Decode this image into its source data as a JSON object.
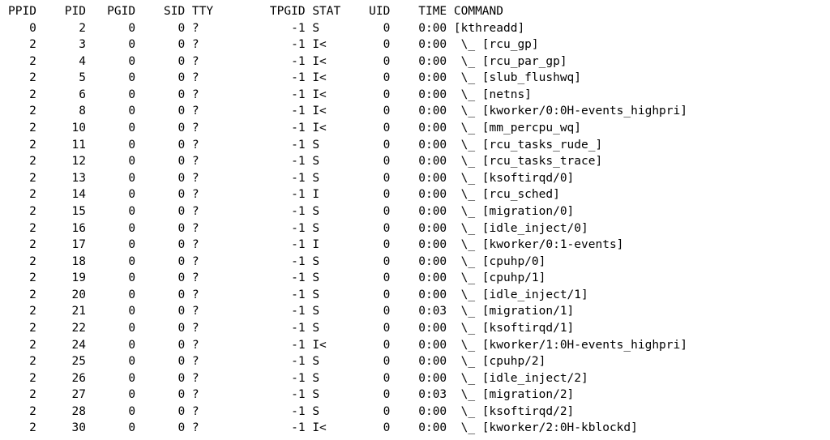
{
  "columns": {
    "ppid": "PPID",
    "pid": "PID",
    "pgid": "PGID",
    "sid": "SID",
    "tty": "TTY",
    "tpgid": "TPGID",
    "stat": "STAT",
    "uid": "UID",
    "time": "TIME",
    "command": "COMMAND"
  },
  "tree_prefix": " \\_ ",
  "rows": [
    {
      "ppid": "0",
      "pid": "2",
      "pgid": "0",
      "sid": "0",
      "tty": "?",
      "tpgid": "-1",
      "stat": "S",
      "uid": "0",
      "time": "0:00",
      "cmd": "[kthreadd]",
      "child": false
    },
    {
      "ppid": "2",
      "pid": "3",
      "pgid": "0",
      "sid": "0",
      "tty": "?",
      "tpgid": "-1",
      "stat": "I<",
      "uid": "0",
      "time": "0:00",
      "cmd": "[rcu_gp]",
      "child": true
    },
    {
      "ppid": "2",
      "pid": "4",
      "pgid": "0",
      "sid": "0",
      "tty": "?",
      "tpgid": "-1",
      "stat": "I<",
      "uid": "0",
      "time": "0:00",
      "cmd": "[rcu_par_gp]",
      "child": true
    },
    {
      "ppid": "2",
      "pid": "5",
      "pgid": "0",
      "sid": "0",
      "tty": "?",
      "tpgid": "-1",
      "stat": "I<",
      "uid": "0",
      "time": "0:00",
      "cmd": "[slub_flushwq]",
      "child": true
    },
    {
      "ppid": "2",
      "pid": "6",
      "pgid": "0",
      "sid": "0",
      "tty": "?",
      "tpgid": "-1",
      "stat": "I<",
      "uid": "0",
      "time": "0:00",
      "cmd": "[netns]",
      "child": true
    },
    {
      "ppid": "2",
      "pid": "8",
      "pgid": "0",
      "sid": "0",
      "tty": "?",
      "tpgid": "-1",
      "stat": "I<",
      "uid": "0",
      "time": "0:00",
      "cmd": "[kworker/0:0H-events_highpri]",
      "child": true
    },
    {
      "ppid": "2",
      "pid": "10",
      "pgid": "0",
      "sid": "0",
      "tty": "?",
      "tpgid": "-1",
      "stat": "I<",
      "uid": "0",
      "time": "0:00",
      "cmd": "[mm_percpu_wq]",
      "child": true
    },
    {
      "ppid": "2",
      "pid": "11",
      "pgid": "0",
      "sid": "0",
      "tty": "?",
      "tpgid": "-1",
      "stat": "S",
      "uid": "0",
      "time": "0:00",
      "cmd": "[rcu_tasks_rude_]",
      "child": true
    },
    {
      "ppid": "2",
      "pid": "12",
      "pgid": "0",
      "sid": "0",
      "tty": "?",
      "tpgid": "-1",
      "stat": "S",
      "uid": "0",
      "time": "0:00",
      "cmd": "[rcu_tasks_trace]",
      "child": true
    },
    {
      "ppid": "2",
      "pid": "13",
      "pgid": "0",
      "sid": "0",
      "tty": "?",
      "tpgid": "-1",
      "stat": "S",
      "uid": "0",
      "time": "0:00",
      "cmd": "[ksoftirqd/0]",
      "child": true
    },
    {
      "ppid": "2",
      "pid": "14",
      "pgid": "0",
      "sid": "0",
      "tty": "?",
      "tpgid": "-1",
      "stat": "I",
      "uid": "0",
      "time": "0:00",
      "cmd": "[rcu_sched]",
      "child": true
    },
    {
      "ppid": "2",
      "pid": "15",
      "pgid": "0",
      "sid": "0",
      "tty": "?",
      "tpgid": "-1",
      "stat": "S",
      "uid": "0",
      "time": "0:00",
      "cmd": "[migration/0]",
      "child": true
    },
    {
      "ppid": "2",
      "pid": "16",
      "pgid": "0",
      "sid": "0",
      "tty": "?",
      "tpgid": "-1",
      "stat": "S",
      "uid": "0",
      "time": "0:00",
      "cmd": "[idle_inject/0]",
      "child": true
    },
    {
      "ppid": "2",
      "pid": "17",
      "pgid": "0",
      "sid": "0",
      "tty": "?",
      "tpgid": "-1",
      "stat": "I",
      "uid": "0",
      "time": "0:00",
      "cmd": "[kworker/0:1-events]",
      "child": true
    },
    {
      "ppid": "2",
      "pid": "18",
      "pgid": "0",
      "sid": "0",
      "tty": "?",
      "tpgid": "-1",
      "stat": "S",
      "uid": "0",
      "time": "0:00",
      "cmd": "[cpuhp/0]",
      "child": true
    },
    {
      "ppid": "2",
      "pid": "19",
      "pgid": "0",
      "sid": "0",
      "tty": "?",
      "tpgid": "-1",
      "stat": "S",
      "uid": "0",
      "time": "0:00",
      "cmd": "[cpuhp/1]",
      "child": true
    },
    {
      "ppid": "2",
      "pid": "20",
      "pgid": "0",
      "sid": "0",
      "tty": "?",
      "tpgid": "-1",
      "stat": "S",
      "uid": "0",
      "time": "0:00",
      "cmd": "[idle_inject/1]",
      "child": true
    },
    {
      "ppid": "2",
      "pid": "21",
      "pgid": "0",
      "sid": "0",
      "tty": "?",
      "tpgid": "-1",
      "stat": "S",
      "uid": "0",
      "time": "0:03",
      "cmd": "[migration/1]",
      "child": true
    },
    {
      "ppid": "2",
      "pid": "22",
      "pgid": "0",
      "sid": "0",
      "tty": "?",
      "tpgid": "-1",
      "stat": "S",
      "uid": "0",
      "time": "0:00",
      "cmd": "[ksoftirqd/1]",
      "child": true
    },
    {
      "ppid": "2",
      "pid": "24",
      "pgid": "0",
      "sid": "0",
      "tty": "?",
      "tpgid": "-1",
      "stat": "I<",
      "uid": "0",
      "time": "0:00",
      "cmd": "[kworker/1:0H-events_highpri]",
      "child": true
    },
    {
      "ppid": "2",
      "pid": "25",
      "pgid": "0",
      "sid": "0",
      "tty": "?",
      "tpgid": "-1",
      "stat": "S",
      "uid": "0",
      "time": "0:00",
      "cmd": "[cpuhp/2]",
      "child": true
    },
    {
      "ppid": "2",
      "pid": "26",
      "pgid": "0",
      "sid": "0",
      "tty": "?",
      "tpgid": "-1",
      "stat": "S",
      "uid": "0",
      "time": "0:00",
      "cmd": "[idle_inject/2]",
      "child": true
    },
    {
      "ppid": "2",
      "pid": "27",
      "pgid": "0",
      "sid": "0",
      "tty": "?",
      "tpgid": "-1",
      "stat": "S",
      "uid": "0",
      "time": "0:03",
      "cmd": "[migration/2]",
      "child": true
    },
    {
      "ppid": "2",
      "pid": "28",
      "pgid": "0",
      "sid": "0",
      "tty": "?",
      "tpgid": "-1",
      "stat": "S",
      "uid": "0",
      "time": "0:00",
      "cmd": "[ksoftirqd/2]",
      "child": true
    },
    {
      "ppid": "2",
      "pid": "30",
      "pgid": "0",
      "sid": "0",
      "tty": "?",
      "tpgid": "-1",
      "stat": "I<",
      "uid": "0",
      "time": "0:00",
      "cmd": "[kworker/2:0H-kblockd]",
      "child": true
    }
  ]
}
